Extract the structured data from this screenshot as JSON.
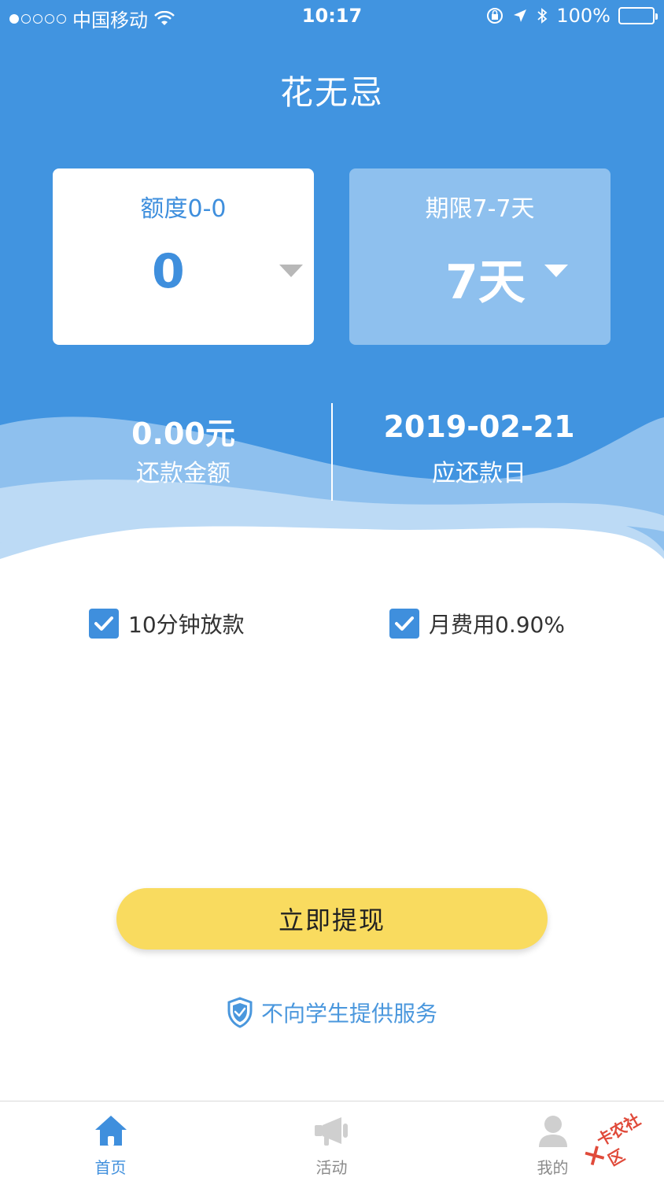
{
  "status_bar": {
    "carrier": "中国移动",
    "time": "10:17",
    "battery_percent": "100%"
  },
  "app": {
    "title": "花无忌"
  },
  "amount_card": {
    "label": "额度0-0",
    "value": "0"
  },
  "term_card": {
    "label": "期限7-7天",
    "value": "7天"
  },
  "summary": {
    "repayment_amount": "0.00元",
    "repayment_amount_label": "还款金额",
    "due_date": "2019-02-21",
    "due_date_label": "应还款日"
  },
  "features": [
    {
      "label": "10分钟放款",
      "checked": true
    },
    {
      "label": "月费用0.90%",
      "checked": true
    }
  ],
  "cta": {
    "label": "立即提现"
  },
  "notice": {
    "text": "不向学生提供服务"
  },
  "tabbar": {
    "items": [
      {
        "label": "首页",
        "icon": "home-icon",
        "active": true
      },
      {
        "label": "活动",
        "icon": "megaphone-icon",
        "active": false
      },
      {
        "label": "我的",
        "icon": "profile-icon",
        "active": false
      }
    ]
  },
  "watermark": {
    "text": "卡农社区"
  },
  "colors": {
    "primary": "#4194e0",
    "card_term_bg": "#8ec0ee",
    "cta_bg": "#f9db5f",
    "accent_text": "#3f8fdd"
  }
}
